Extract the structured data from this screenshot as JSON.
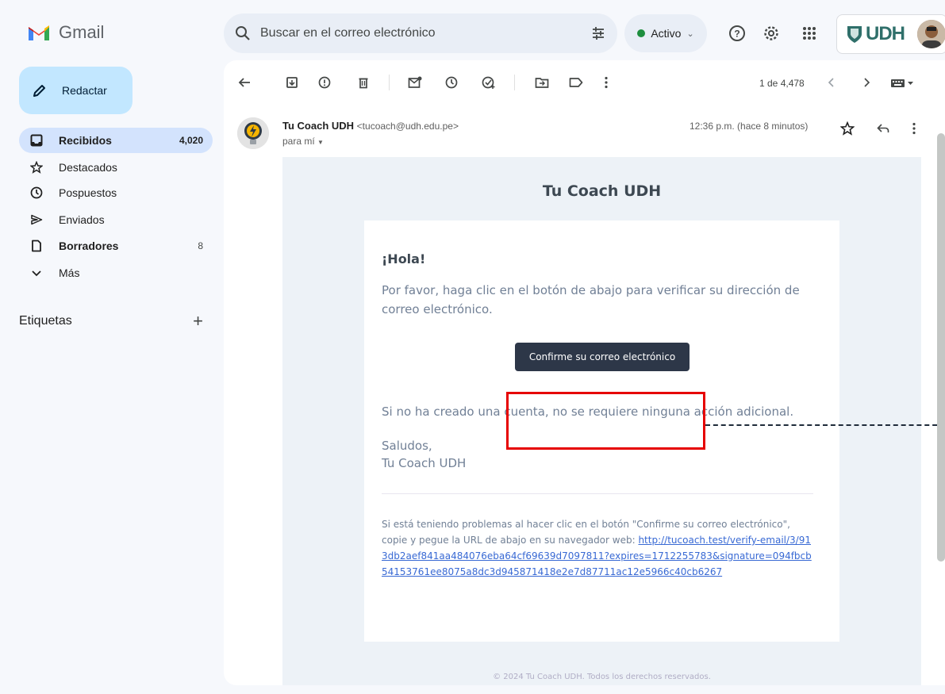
{
  "app": {
    "name": "Gmail"
  },
  "search": {
    "placeholder": "Buscar en el correo electrónico"
  },
  "status": {
    "label": "Activo"
  },
  "account": {
    "org_logo_text": "UDH"
  },
  "compose": {
    "label": "Redactar"
  },
  "sidebar": {
    "items": [
      {
        "label": "Recibidos",
        "count": "4,020"
      },
      {
        "label": "Destacados",
        "count": ""
      },
      {
        "label": "Pospuestos",
        "count": ""
      },
      {
        "label": "Enviados",
        "count": ""
      },
      {
        "label": "Borradores",
        "count": "8"
      },
      {
        "label": "Más",
        "count": ""
      }
    ],
    "labels_title": "Etiquetas",
    "labels_add": "+"
  },
  "toolbar": {
    "pager": "1 de 4,478"
  },
  "message": {
    "sender_name": "Tu Coach UDH",
    "sender_email": "<tucoach@udh.edu.pe>",
    "to": "para mí",
    "time": "12:36 p.m. (hace 8 minutos)"
  },
  "email": {
    "title": "Tu Coach UDH",
    "greeting": "¡Hola!",
    "intro": "Por favor, haga clic en el botón de abajo para verificar su dirección de correo electrónico.",
    "button": "Confirme su correo electrónico",
    "no_action": "Si no ha creado una cuenta, no se requiere ninguna acción adicional.",
    "salutation": "Saludos,",
    "signature": "Tu Coach UDH",
    "trouble_text": "Si está teniendo problemas al hacer clic en el botón \"Confirme su correo electrónico\", copie y pegue la URL de abajo en su navegador web: ",
    "link": "http://tucoach.test/verify-email/3/913db2aef841aa484076eba64cf69639d7097811?expires=1712255783&signature=094fbcb54153761ee8075a8dc3d945871418e2e7d87711ac12e5966c40cb6267",
    "footer": "© 2024 Tu Coach UDH. Todos los derechos reservados."
  },
  "colors": {
    "compose_bg": "#c2e7ff",
    "active_nav_bg": "#d3e3fd",
    "button_bg": "#2d3748",
    "highlight": "#e60000",
    "link": "#3869d4"
  }
}
